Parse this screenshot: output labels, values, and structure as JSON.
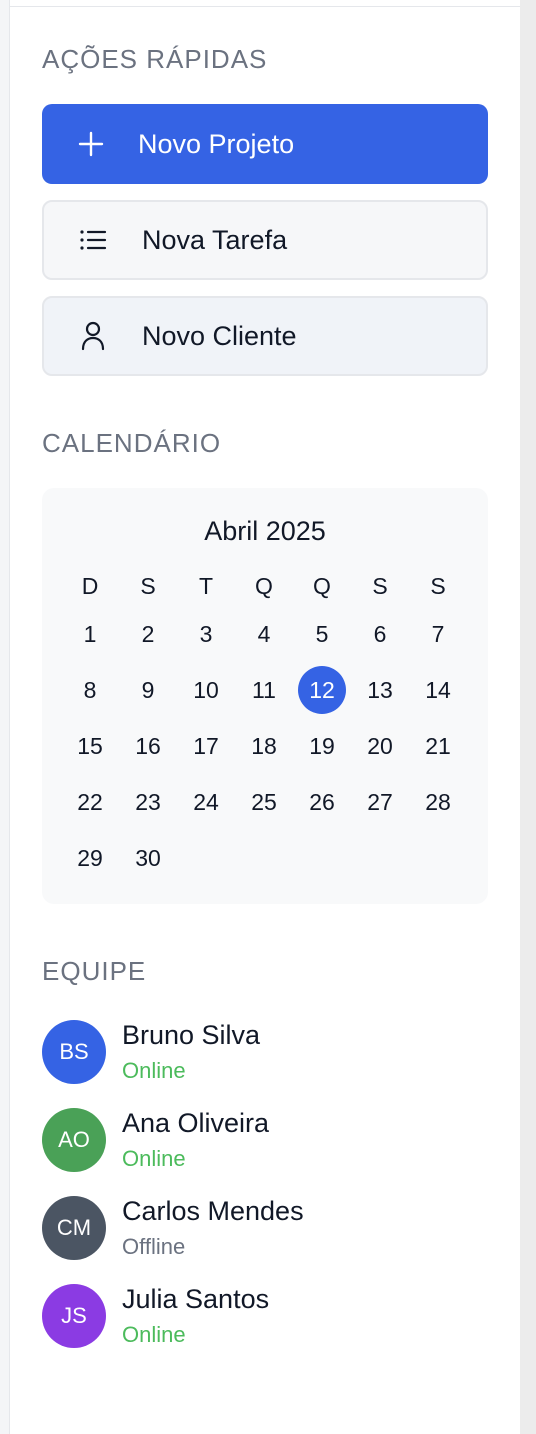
{
  "quick_actions": {
    "title": "AÇÕES RÁPIDAS",
    "buttons": [
      {
        "label": "Novo Projeto",
        "icon": "plus-icon",
        "style": "primary"
      },
      {
        "label": "Nova Tarefa",
        "icon": "list-icon",
        "style": "secondary"
      },
      {
        "label": "Novo Cliente",
        "icon": "user-icon",
        "style": "secondary"
      }
    ]
  },
  "calendar": {
    "title": "CALENDÁRIO",
    "month_label": "Abril 2025",
    "weekdays": [
      "D",
      "S",
      "T",
      "Q",
      "Q",
      "S",
      "S"
    ],
    "start_offset": 0,
    "days_in_month": 30,
    "selected_day": 12
  },
  "team": {
    "title": "EQUIPE",
    "members": [
      {
        "initials": "BS",
        "name": "Bruno Silva",
        "status": "Online",
        "avatar_color": "#3563e4",
        "status_color": "#4cbb5c"
      },
      {
        "initials": "AO",
        "name": "Ana Oliveira",
        "status": "Online",
        "avatar_color": "#4aa157",
        "status_color": "#4cbb5c"
      },
      {
        "initials": "CM",
        "name": "Carlos Mendes",
        "status": "Offline",
        "avatar_color": "#4b5563",
        "status_color": "#6b7280"
      },
      {
        "initials": "JS",
        "name": "Julia Santos",
        "status": "Online",
        "avatar_color": "#8b3be3",
        "status_color": "#4cbb5c"
      }
    ]
  },
  "colors": {
    "accent": "#3563e4",
    "online": "#4cbb5c",
    "offline": "#6b7280"
  }
}
